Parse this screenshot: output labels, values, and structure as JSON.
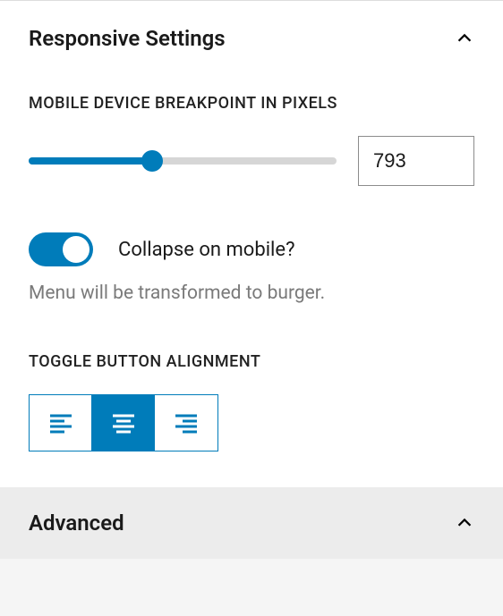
{
  "responsive": {
    "title": "Responsive Settings",
    "breakpoint_label": "MOBILE DEVICE BREAKPOINT IN PIXELS",
    "breakpoint_value": "793",
    "collapse_label": "Collapse on mobile?",
    "collapse_enabled": true,
    "helper_text": "Menu will be transformed to burger.",
    "alignment_label": "TOGGLE BUTTON ALIGNMENT",
    "alignment_options": [
      "left",
      "center",
      "right"
    ],
    "alignment_selected": "center"
  },
  "advanced": {
    "title": "Advanced"
  },
  "colors": {
    "accent": "#007cba"
  }
}
